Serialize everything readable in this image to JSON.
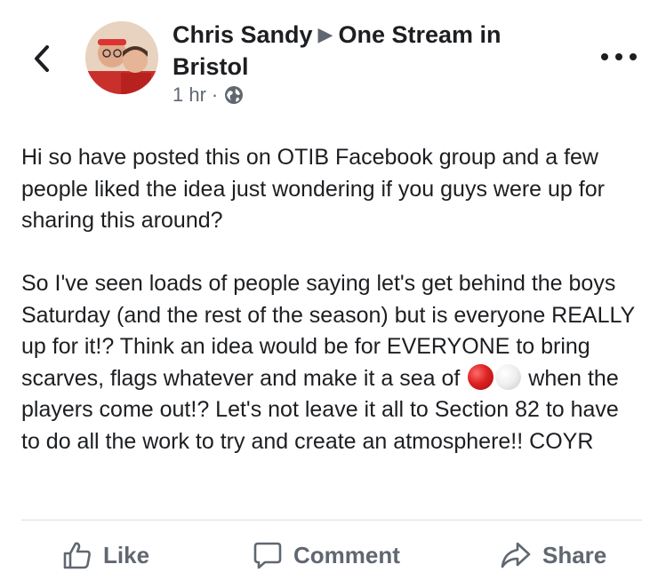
{
  "header": {
    "author": "Chris Sandy",
    "arrow": "▶",
    "group": "One Stream in Bristol",
    "time": "1 hr",
    "separator": "·",
    "privacy_icon": "globe-icon",
    "back_icon": "chevron-left-icon",
    "more_icon": "more-horizontal-icon"
  },
  "post": {
    "paragraph1": "Hi so have posted this on OTIB Facebook group and a few people liked the idea just wondering if you guys were up for sharing this around?",
    "paragraph2_before": "So I've seen loads of people saying let's get behind the boys Saturday (and the rest of the season) but is everyone REALLY up for it!? Think an idea would be for EVERYONE to bring scarves, flags whatever and make it a sea of",
    "paragraph2_after": "when the players come out!? Let's not leave it all to Section 82 to have to do all the work to try and create an atmosphere!! COYR",
    "emojis": [
      "red-circle",
      "white-circle"
    ]
  },
  "actions": {
    "like": "Like",
    "comment": "Comment",
    "share": "Share"
  },
  "colors": {
    "text": "#1c1e21",
    "secondary": "#606770",
    "divider": "#dadde1"
  }
}
